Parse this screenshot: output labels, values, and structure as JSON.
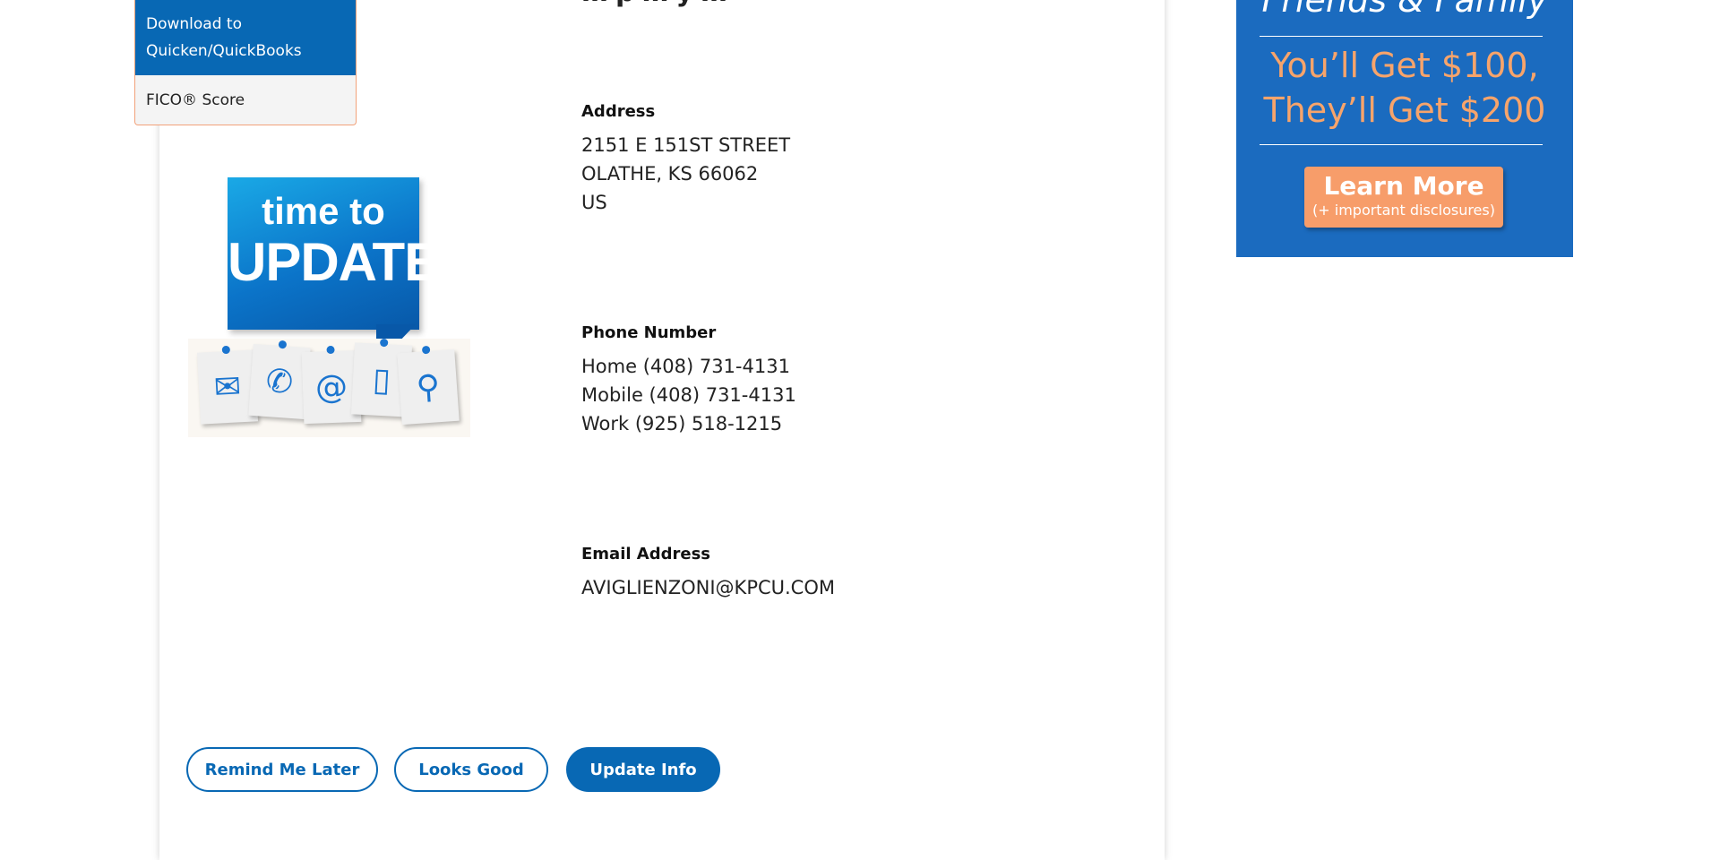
{
  "page": {
    "title_fragment": "…p…y…"
  },
  "menu": {
    "items": [
      {
        "label": "Download to Quicken/QuickBooks",
        "active": true
      },
      {
        "label": "FICO® Score",
        "active": false
      }
    ]
  },
  "illustration": {
    "headline_small": "time to",
    "headline_big": "UPDATE",
    "notes": [
      "envelope-icon",
      "phone-icon",
      "at-sign-icon",
      "mobile-icon",
      "location-pin-icon"
    ]
  },
  "contact": {
    "address_label": "Address",
    "address_lines": [
      "2151 E 151ST STREET",
      "OLATHE, KS 66062",
      "US"
    ],
    "phone_label": "Phone Number",
    "phone_lines": [
      "Home (408) 731-4131",
      "Mobile (408) 731-4131",
      "Work (925) 518-1215"
    ],
    "email_label": "Email Address",
    "email": "AVIGLIENZONI@KPCU.COM"
  },
  "actions": {
    "remind_label": "Remind Me Later",
    "looks_good_label": "Looks Good",
    "update_label": "Update Info"
  },
  "ad": {
    "heading": "Friends & Family",
    "offer_line1": "You’ll Get $100,",
    "offer_line2": "They’ll Get $200",
    "button_main": "Learn More",
    "button_sub": "(+ important disclosures)"
  },
  "colors": {
    "brand_blue": "#0868b4",
    "ad_blue": "#1b6bbf",
    "ad_orange": "#f79d6a"
  }
}
